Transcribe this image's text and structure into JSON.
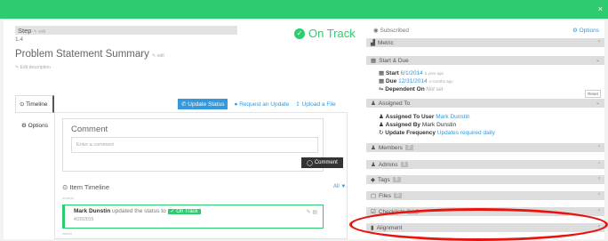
{
  "header": {
    "close_icon": "×"
  },
  "step": {
    "label": "Step",
    "edit": "edit",
    "number": "1.4"
  },
  "status": {
    "icon": "✓",
    "text": "On Track"
  },
  "task": {
    "title": "Problem Statement Summary",
    "edit": "edit",
    "edit_description": "Edit description"
  },
  "nav": {
    "timeline": "Timeline",
    "options": "Options"
  },
  "actions": {
    "update_status": "Update Status",
    "request_update": "Request an Update",
    "upload_file": "Upload a File"
  },
  "comment": {
    "title": "Comment",
    "placeholder": "Enter a comment",
    "button": "Comment"
  },
  "timeline": {
    "title": "Item Timeline",
    "filter": "All",
    "recent_label": "newest",
    "older_label": "oldest",
    "event": {
      "user": "Mark Dunstin",
      "text": "updated the status to",
      "badge": "On Track",
      "date": "4/20/2015"
    }
  },
  "sidebar": {
    "subscribed": "Subscribed",
    "options": "Options",
    "metric": "Metric",
    "start_due": {
      "title": "Start & Due",
      "start_label": "Start",
      "start_value": "6/1/2014",
      "start_ago": "a year ago",
      "due_label": "Due",
      "due_value": "12/31/2014",
      "due_ago": "4 months ago",
      "dependent_label": "Dependent On",
      "dependent_value": "Not set",
      "reset": "Reset"
    },
    "assigned_to": {
      "title": "Assigned To",
      "user_label": "Assigned To User",
      "user_value": "Mark Dunstin",
      "by_label": "Assigned By",
      "by_value": "Mark Dunstin",
      "freq_label": "Update Frequency",
      "freq_value": "Updates required daily"
    },
    "members": {
      "label": "Members",
      "count": "2"
    },
    "admins": {
      "label": "Admins",
      "count": "1"
    },
    "tags": {
      "label": "Tags",
      "count": "0"
    },
    "files": {
      "label": "Files",
      "count": "0"
    },
    "checklists": {
      "label": "Checklists",
      "count": "0/0"
    },
    "alignment": "Alignment"
  },
  "colors": {
    "accent_green": "#2ecc71",
    "link_blue": "#3498db",
    "highlight_red": "#e8140f"
  }
}
